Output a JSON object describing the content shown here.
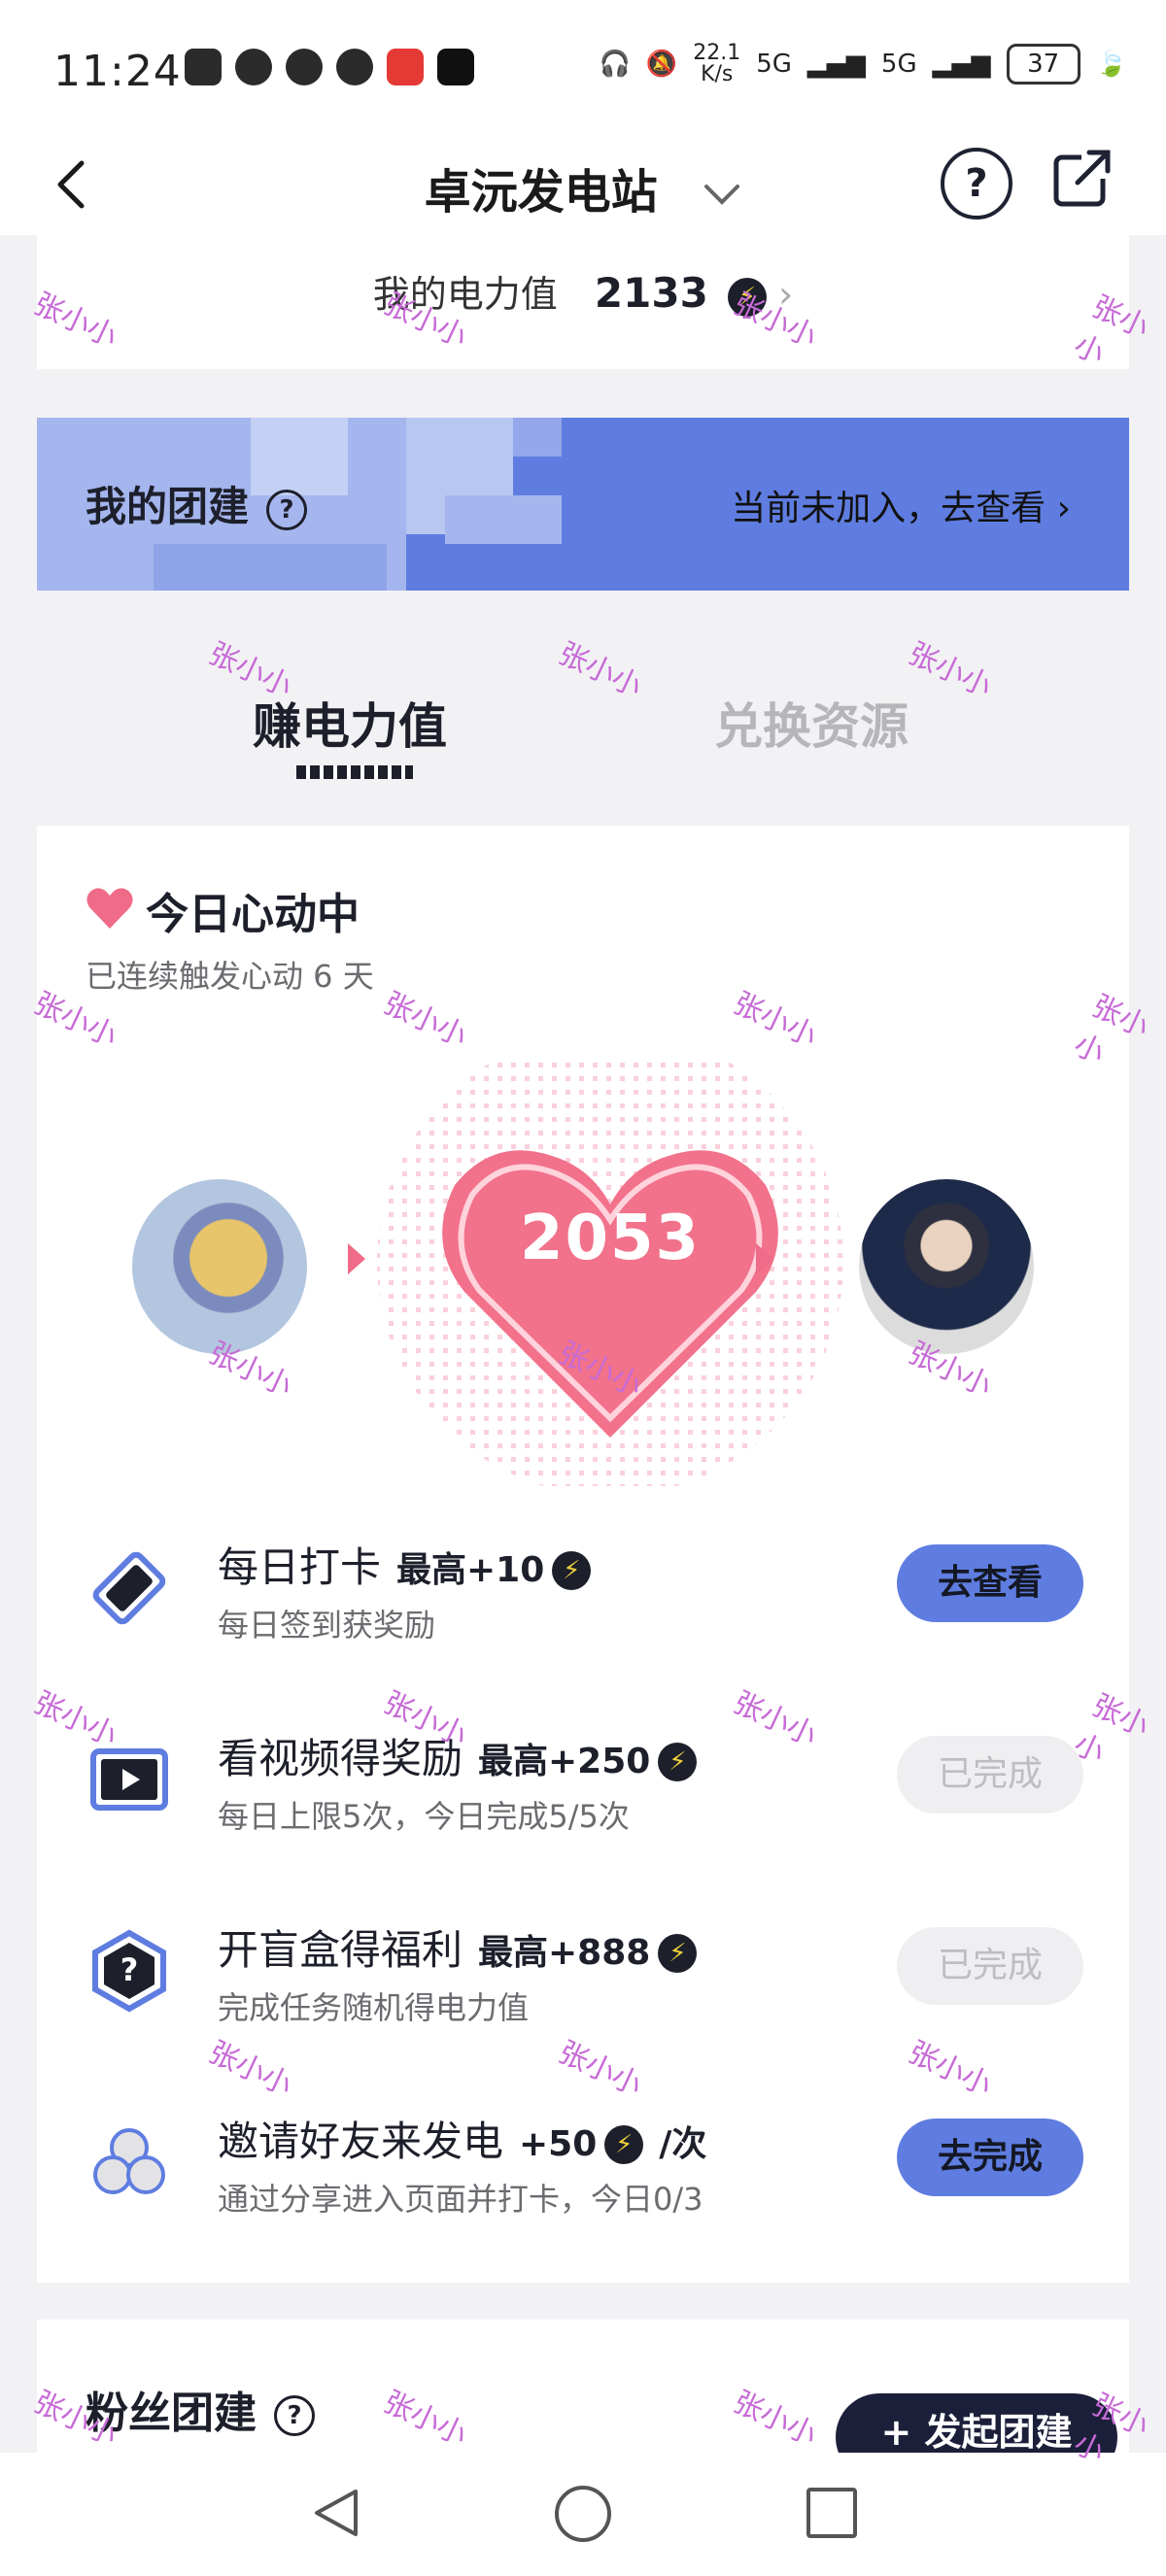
{
  "status_bar": {
    "time": "11:24",
    "net_speed_value": "22.1",
    "net_speed_unit": "K/s",
    "signal_1": "5G",
    "signal_2": "5G",
    "battery": "37"
  },
  "nav": {
    "title": "卓沅发电站",
    "help_glyph": "?"
  },
  "power": {
    "label": "我的电力值",
    "value": "2133"
  },
  "team": {
    "title": "我的团建",
    "help_glyph": "?",
    "action": "当前未加入，去查看"
  },
  "tabs": [
    {
      "label": "赚电力值",
      "active": true
    },
    {
      "label": "兑换资源",
      "active": false
    }
  ],
  "heart_section": {
    "title": "今日心动中",
    "subtitle": "已连续触发心动 6 天",
    "count": "2053"
  },
  "tasks": [
    {
      "title": "每日打卡",
      "reward": "最高+10",
      "suffix": "",
      "desc": "每日签到获奖励",
      "button": "去查看",
      "state": "active",
      "icon": "ticket-icon"
    },
    {
      "title": "看视频得奖励",
      "reward": "最高+250",
      "suffix": "",
      "desc": "每日上限5次，今日完成5/5次",
      "button": "已完成",
      "state": "done",
      "icon": "video-icon"
    },
    {
      "title": "开盲盒得福利",
      "reward": "最高+888",
      "suffix": "",
      "desc": "完成任务随机得电力值",
      "button": "已完成",
      "state": "done",
      "icon": "mystery-box-icon"
    },
    {
      "title": "邀请好友来发电",
      "reward": "+50",
      "suffix": "/次",
      "desc": "通过分享进入页面并打卡，今日0/3",
      "button": "去完成",
      "state": "active",
      "icon": "friends-icon"
    }
  ],
  "fans": {
    "title": "粉丝团建",
    "help_glyph": "?",
    "launch_button": "+ 发起团建"
  },
  "watermark_text": "张小小",
  "colors": {
    "accent": "#5f7de0",
    "heart": "#f06b87",
    "dark": "#1d1f2b",
    "background": "#f2f2f4"
  }
}
